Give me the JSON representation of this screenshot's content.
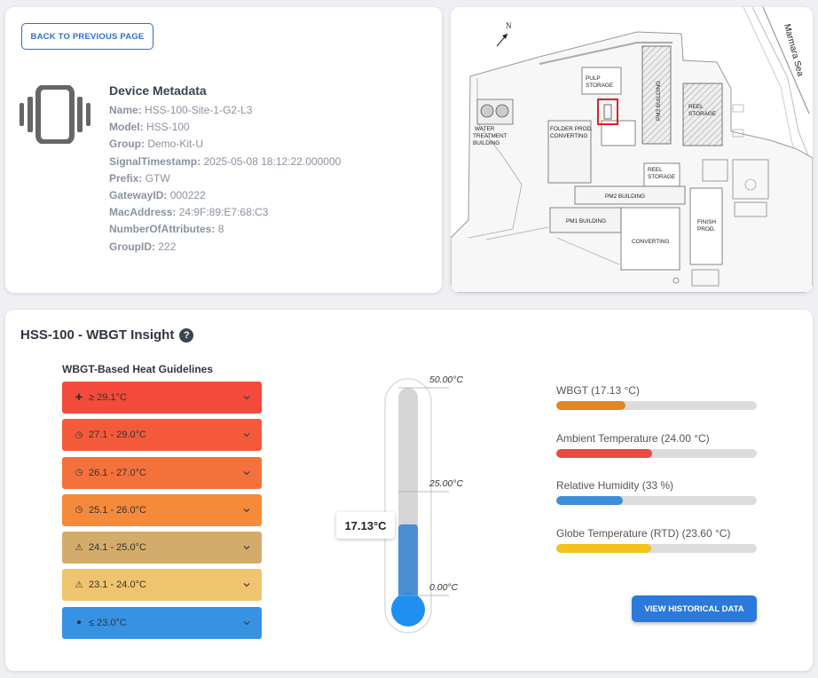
{
  "header": {
    "back_label": "BACK TO PREVIOUS PAGE"
  },
  "device": {
    "title": "Device Metadata",
    "icon": "vibrating-phone-icon",
    "fields": [
      {
        "key": "Name:",
        "value": "HSS-100-Site-1-G2-L3"
      },
      {
        "key": "Model:",
        "value": "HSS-100"
      },
      {
        "key": "Group:",
        "value": "Demo-Kit-U"
      },
      {
        "key": "SignalTimestamp:",
        "value": "2025-05-08 18:12:22.000000"
      },
      {
        "key": "Prefix:",
        "value": "GTW"
      },
      {
        "key": "GatewayID:",
        "value": "000222"
      },
      {
        "key": "MacAddress:",
        "value": "24:9F:89:E7:68:C3"
      },
      {
        "key": "NumberOfAttributes:",
        "value": "8"
      },
      {
        "key": "GroupID:",
        "value": "222"
      }
    ]
  },
  "map": {
    "north": "N",
    "sea": "Marmara Sea",
    "labels": {
      "pulp1": "PULP",
      "pulp2": "STORAGE",
      "pm3": "PM3 BUILDING",
      "reel1a": "REEL",
      "reel1b": "STORAGE",
      "water1": "WATER",
      "water2": "TREATMENT",
      "water3": "BUILDING",
      "folder1": "FOLDER PROD.",
      "folder2": "CONVERTING",
      "reel2a": "REEL",
      "reel2b": "STORAGE",
      "pm2": "PM2 BUILDING",
      "pm1": "PM1 BUILDING",
      "converting": "CONVERTING",
      "finish1": "FINISH",
      "finish2": "PROD."
    },
    "marker_color": "#e02020"
  },
  "insight": {
    "title": "HSS-100 - WBGT Insight",
    "help_icon": "?",
    "guidelines_title": "WBGT-Based Heat Guidelines",
    "guidelines": [
      {
        "icon": "hospital-icon",
        "glyph": "✚",
        "label": "≥ 29.1°C",
        "color": "#f34a3c"
      },
      {
        "icon": "clock-icon",
        "glyph": "◷",
        "label": "27.1 - 29.0°C",
        "color": "#f45a3a"
      },
      {
        "icon": "clock-icon",
        "glyph": "◷",
        "label": "26.1 - 27.0°C",
        "color": "#f5713b"
      },
      {
        "icon": "clock-icon",
        "glyph": "◷",
        "label": "25.1 - 26.0°C",
        "color": "#f48a3a"
      },
      {
        "icon": "warning-icon",
        "glyph": "⚠",
        "label": "24.1 - 25.0°C",
        "color": "#d3ac6b"
      },
      {
        "icon": "warning-icon",
        "glyph": "⚠",
        "label": "23.1 - 24.0°C",
        "color": "#f0c46e"
      },
      {
        "icon": "droplet-icon",
        "glyph": "●",
        "label": "≤ 23.0°C",
        "color": "#3892e3"
      }
    ],
    "thermometer": {
      "max_label": "50.00°C",
      "mid_label": "25.00°C",
      "min_label": "0.00°C",
      "max": 50,
      "min": 0,
      "value": 17.13,
      "readout": "17.13°C",
      "fill_color": "#4a8fd1",
      "bulb_color": "#1f8ff0"
    },
    "metrics": [
      {
        "label": "WBGT (17.13 °C)",
        "fraction": 0.343,
        "color": "#e08624"
      },
      {
        "label": "Ambient Temperature (24.00 °C)",
        "fraction": 0.48,
        "color": "#ea4b3e"
      },
      {
        "label": "Relative Humidity (33 %)",
        "fraction": 0.33,
        "color": "#3c8fd8"
      },
      {
        "label": "Globe Temperature (RTD) (23.60 °C)",
        "fraction": 0.472,
        "color": "#f1c41a"
      }
    ],
    "historical_label": "VIEW HISTORICAL DATA"
  }
}
